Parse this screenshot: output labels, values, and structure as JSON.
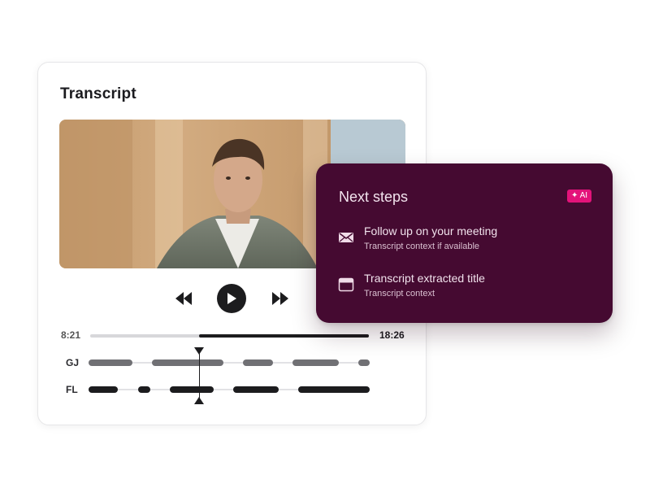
{
  "transcript": {
    "title": "Transcript",
    "player": {
      "current_time": "8:21",
      "total_time": "18:26",
      "progress_fraction": 0.39
    },
    "speakers": [
      {
        "label": "GJ",
        "color": "#707074",
        "segments": [
          [
            0.0,
            0.155
          ],
          [
            0.225,
            0.48
          ],
          [
            0.55,
            0.655
          ],
          [
            0.725,
            0.89
          ],
          [
            0.96,
            1.0
          ]
        ]
      },
      {
        "label": "FL",
        "color": "#1c1c1e",
        "segments": [
          [
            0.0,
            0.105
          ],
          [
            0.175,
            0.22
          ],
          [
            0.29,
            0.445
          ],
          [
            0.515,
            0.675
          ],
          [
            0.745,
            1.0
          ]
        ]
      }
    ],
    "scrubber_fraction": 0.4
  },
  "next_steps": {
    "title": "Next steps",
    "badge": "✦ AI",
    "items": [
      {
        "icon": "envelope-icon",
        "title": "Follow up on your meeting",
        "subtitle": "Transcript context if available"
      },
      {
        "icon": "window-icon",
        "title": "Transcript extracted title",
        "subtitle": "Transcript context"
      }
    ]
  },
  "colors": {
    "card_accent": "#450a31",
    "badge": "#e3137a",
    "dark": "#1c1c1e"
  }
}
